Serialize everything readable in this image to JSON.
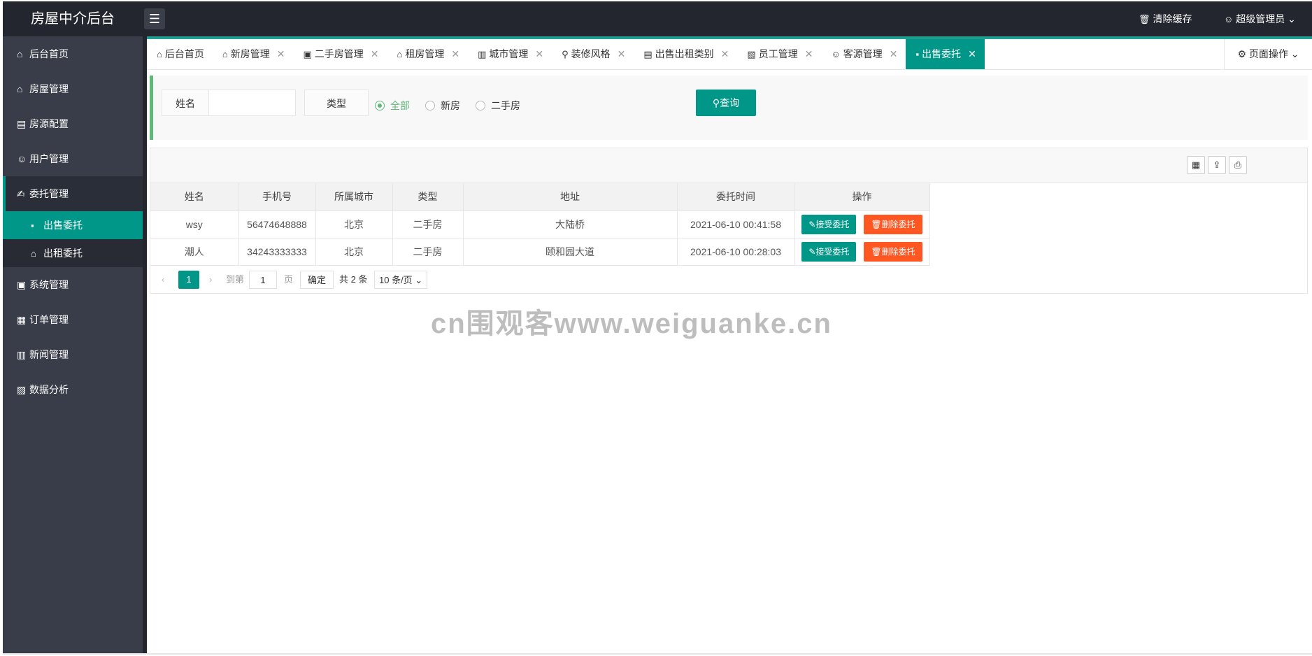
{
  "header": {
    "app_title": "房屋中介后台",
    "menu_toggle_glyph": "☰",
    "clear_cache_label": "清除缓存",
    "admin_label": "超级管理员"
  },
  "sidebar": {
    "items": [
      {
        "label": "后台首页",
        "icon": "home-icon",
        "glyph": "⌂"
      },
      {
        "label": "房屋管理",
        "icon": "house-icon",
        "glyph": "⌂"
      },
      {
        "label": "房源配置",
        "icon": "building-icon",
        "glyph": "▤"
      },
      {
        "label": "用户管理",
        "icon": "user-icon",
        "glyph": "☺"
      },
      {
        "label": "委托管理",
        "icon": "entrust-icon",
        "glyph": "✍"
      },
      {
        "label": "系统管理",
        "icon": "system-icon",
        "glyph": "▣"
      },
      {
        "label": "订单管理",
        "icon": "order-icon",
        "glyph": "▦"
      },
      {
        "label": "新闻管理",
        "icon": "news-icon",
        "glyph": "▥"
      },
      {
        "label": "数据分析",
        "icon": "chart-icon",
        "glyph": "▨"
      }
    ],
    "sub_items": [
      {
        "label": "出售委托",
        "icon": "sale-icon",
        "glyph": "▪"
      },
      {
        "label": "出租委托",
        "icon": "rent-icon",
        "glyph": "⌂"
      }
    ]
  },
  "tabs": [
    {
      "label": "后台首页",
      "glyph": "⌂",
      "closable": false
    },
    {
      "label": "新房管理",
      "glyph": "⌂",
      "closable": true
    },
    {
      "label": "二手房管理",
      "glyph": "▣",
      "closable": true
    },
    {
      "label": "租房管理",
      "glyph": "⌂",
      "closable": true
    },
    {
      "label": "城市管理",
      "glyph": "▥",
      "closable": true
    },
    {
      "label": "装修风格",
      "glyph": "⚲",
      "closable": true
    },
    {
      "label": "出售出租类别",
      "glyph": "▤",
      "closable": true
    },
    {
      "label": "员工管理",
      "glyph": "▧",
      "closable": true
    },
    {
      "label": "客源管理",
      "glyph": "☺",
      "closable": true
    },
    {
      "label": "出售委托",
      "glyph": "▪",
      "closable": true
    }
  ],
  "page_ops_label": "页面操作",
  "search": {
    "name_label": "姓名",
    "name_value": "",
    "type_label": "类型",
    "radio_all": "全部",
    "radio_new": "新房",
    "radio_second": "二手房",
    "selected": "全部",
    "query_label": "查询"
  },
  "table": {
    "columns": [
      "姓名",
      "手机号",
      "所属城市",
      "类型",
      "地址",
      "委托时间",
      "操作"
    ],
    "rows": [
      {
        "name": "wsy",
        "phone": "56474648888",
        "city": "北京",
        "type": "二手房",
        "address": "大陆桥",
        "time": "2021-06-10 00:41:58"
      },
      {
        "name": "潮人",
        "phone": "34243333333",
        "city": "北京",
        "type": "二手房",
        "address": "颐和园大道",
        "time": "2021-06-10 00:28:03"
      }
    ],
    "accept_label": "接受委托",
    "delete_label": "删除委托"
  },
  "pager": {
    "prev": "‹",
    "current": "1",
    "next": "›",
    "goto_label": "到第",
    "goto_value": "1",
    "page_unit": "页",
    "ok_label": "确定",
    "total_label": "共 2 条",
    "page_size": "10 条/页"
  },
  "watermark": "cn围观客www.weiguanke.cn"
}
